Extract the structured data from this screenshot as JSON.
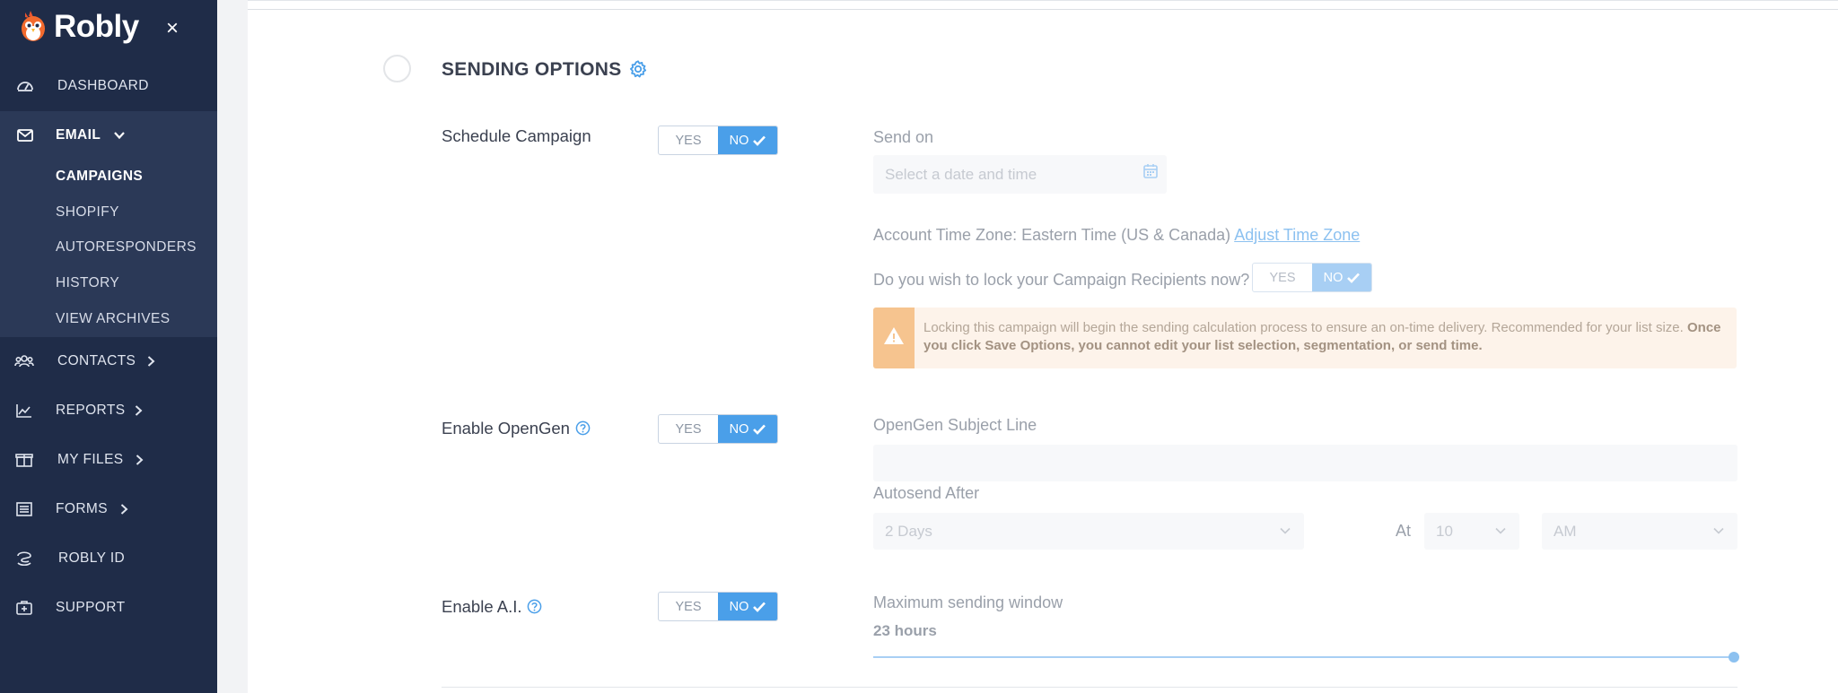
{
  "app": {
    "name": "Robly",
    "close_label": "×"
  },
  "sidebar": {
    "items": [
      {
        "label": "DASHBOARD",
        "icon": "dashboard-icon"
      },
      {
        "label": "EMAIL",
        "icon": "envelope-icon",
        "expanded": true
      },
      {
        "label": "CONTACTS",
        "icon": "users-icon"
      },
      {
        "label": "REPORTS",
        "icon": "chart-icon"
      },
      {
        "label": "MY FILES",
        "icon": "box-icon"
      },
      {
        "label": "FORMS",
        "icon": "form-icon"
      },
      {
        "label": "ROBLY ID",
        "icon": "robly-id-icon"
      },
      {
        "label": "SUPPORT",
        "icon": "support-icon"
      }
    ],
    "email_sub": [
      "CAMPAIGNS",
      "SHOPIFY",
      "AUTORESPONDERS",
      "HISTORY",
      "VIEW ARCHIVES"
    ],
    "active_sub": "CAMPAIGNS"
  },
  "section": {
    "title": "SENDING OPTIONS"
  },
  "toggle_labels": {
    "yes": "YES",
    "no": "NO"
  },
  "schedule": {
    "label": "Schedule Campaign",
    "value": "NO",
    "send_on_label": "Send on",
    "date_placeholder": "Select a date and time",
    "timezone_text": "Account Time Zone: Eastern Time (US & Canada)",
    "adjust_link": "Adjust Time Zone",
    "lock_question": "Do you wish to lock your Campaign Recipients now?",
    "lock_value": "NO",
    "warning_text": "Locking this campaign will begin the sending calculation process to ensure an on-time delivery. Recommended for your list size.",
    "warning_bold": "Once you click Save Options, you cannot edit your list selection, segmentation, or send time."
  },
  "opengen": {
    "label": "Enable OpenGen",
    "value": "NO",
    "subject_label": "OpenGen Subject Line",
    "subject_value": "",
    "autosend_label": "Autosend After",
    "autosend_value": "2 Days",
    "at_label": "At",
    "hour_value": "10",
    "ampm_value": "AM"
  },
  "ai": {
    "label": "Enable A.I.",
    "value": "NO",
    "window_label": "Maximum sending window",
    "window_value": "23 hours",
    "slider_fraction": 0.998
  },
  "colors": {
    "sidebar_bg": "#1f2c48",
    "sidebar_active_bg": "#2b3957",
    "accent": "#4a9fe9",
    "accent_disabled": "#a8cff4",
    "warning_bar": "#f6c48f",
    "warning_bg": "#fdf3ea"
  }
}
